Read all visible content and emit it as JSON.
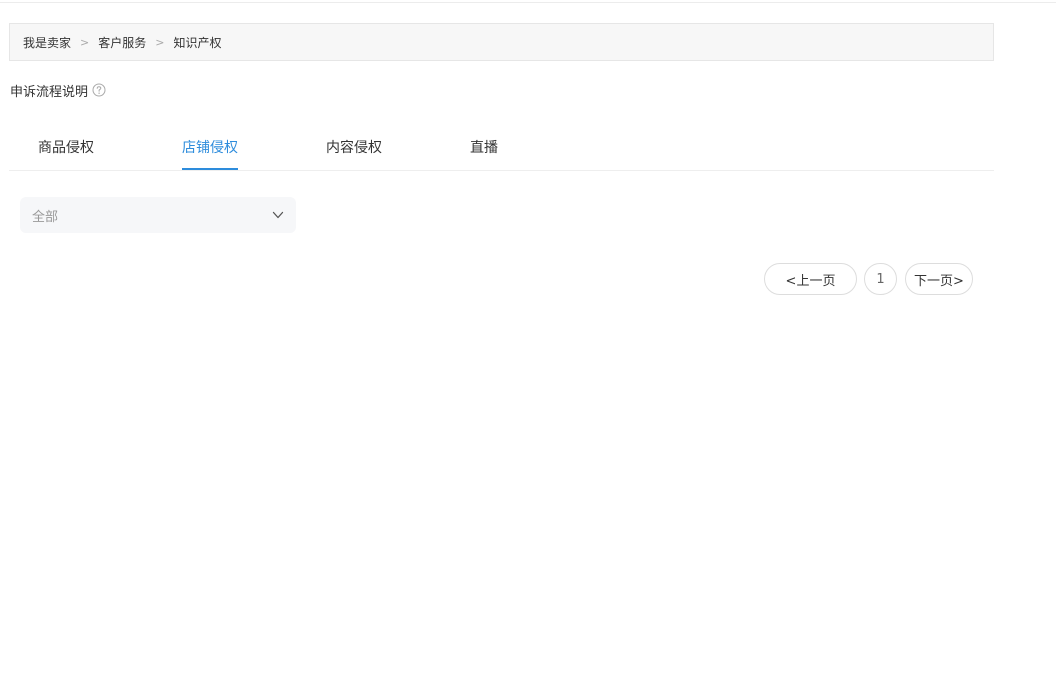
{
  "breadcrumb": {
    "items": [
      "我是卖家",
      "客户服务",
      "知识产权"
    ],
    "separator": ">"
  },
  "appeal": {
    "label": "申诉流程说明",
    "icon": "help-circle-icon"
  },
  "tabs": [
    {
      "label": "商品侵权",
      "active": false
    },
    {
      "label": "店铺侵权",
      "active": true
    },
    {
      "label": "内容侵权",
      "active": false
    },
    {
      "label": "直播",
      "active": false
    }
  ],
  "filter": {
    "selected": "全部",
    "icon": "chevron-down-icon"
  },
  "pagination": {
    "prev_label": "<上一页",
    "current_page": "1",
    "next_label": "下一页>"
  },
  "colors": {
    "accent": "#2d8cdc",
    "breadcrumb_bg": "#f7f7f7",
    "select_bg": "#f6f7f9"
  }
}
